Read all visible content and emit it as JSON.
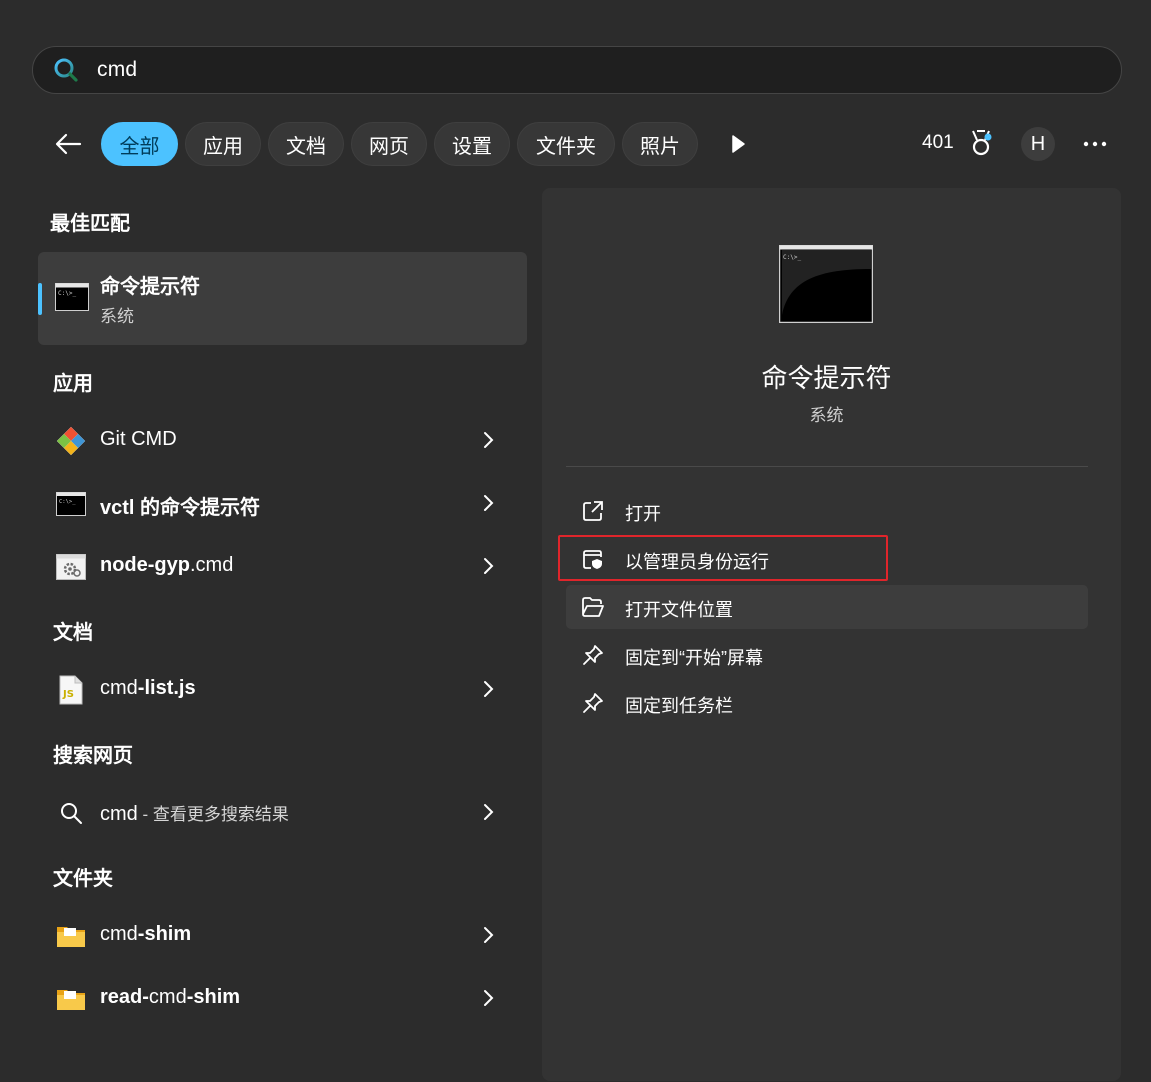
{
  "search": {
    "query": "cmd"
  },
  "filters": [
    {
      "label": "全部",
      "active": true
    },
    {
      "label": "应用"
    },
    {
      "label": "文档"
    },
    {
      "label": "网页"
    },
    {
      "label": "设置"
    },
    {
      "label": "文件夹"
    },
    {
      "label": "照片"
    }
  ],
  "header": {
    "points": "401",
    "avatar_initial": "H"
  },
  "sections": {
    "best_match": "最佳匹配",
    "apps": "应用",
    "docs": "文档",
    "web": "搜索网页",
    "folders": "文件夹"
  },
  "best_match": {
    "title": "命令提示符",
    "subtitle": "系统"
  },
  "apps": [
    {
      "label": "Git CMD",
      "icon": "git-icon"
    },
    {
      "label": "vctl 的命令提示符",
      "icon": "cmd-icon"
    },
    {
      "label_prefix": "node-gyp",
      "label_rest": ".cmd",
      "icon": "settings-file-icon"
    }
  ],
  "docs": [
    {
      "label_prefix": "cmd",
      "label_rest": "-list.js",
      "icon": "js-file-icon"
    }
  ],
  "web": [
    {
      "query": "cmd",
      "suffix": " - 查看更多搜索结果",
      "icon": "search-icon"
    }
  ],
  "folders": [
    {
      "label_prefix": "cmd",
      "label_rest": "-shim",
      "icon": "folder-icon"
    },
    {
      "label_prefix": "read-",
      "label_mid": "cmd",
      "label_rest": "-shim",
      "icon": "folder-icon"
    }
  ],
  "detail": {
    "title": "命令提示符",
    "subtitle": "系统",
    "actions": [
      {
        "label": "打开",
        "icon": "open-external-icon"
      },
      {
        "label": "以管理员身份运行",
        "icon": "shield-admin-icon"
      },
      {
        "label": "打开文件位置",
        "icon": "folder-open-icon"
      },
      {
        "label": "固定到“开始”屏幕",
        "icon": "pin-icon"
      },
      {
        "label": "固定到任务栏",
        "icon": "pin-icon"
      }
    ]
  },
  "colors": {
    "accent": "#4cc2ff",
    "highlight_border": "#e0252b",
    "background": "#2c2c2c"
  }
}
